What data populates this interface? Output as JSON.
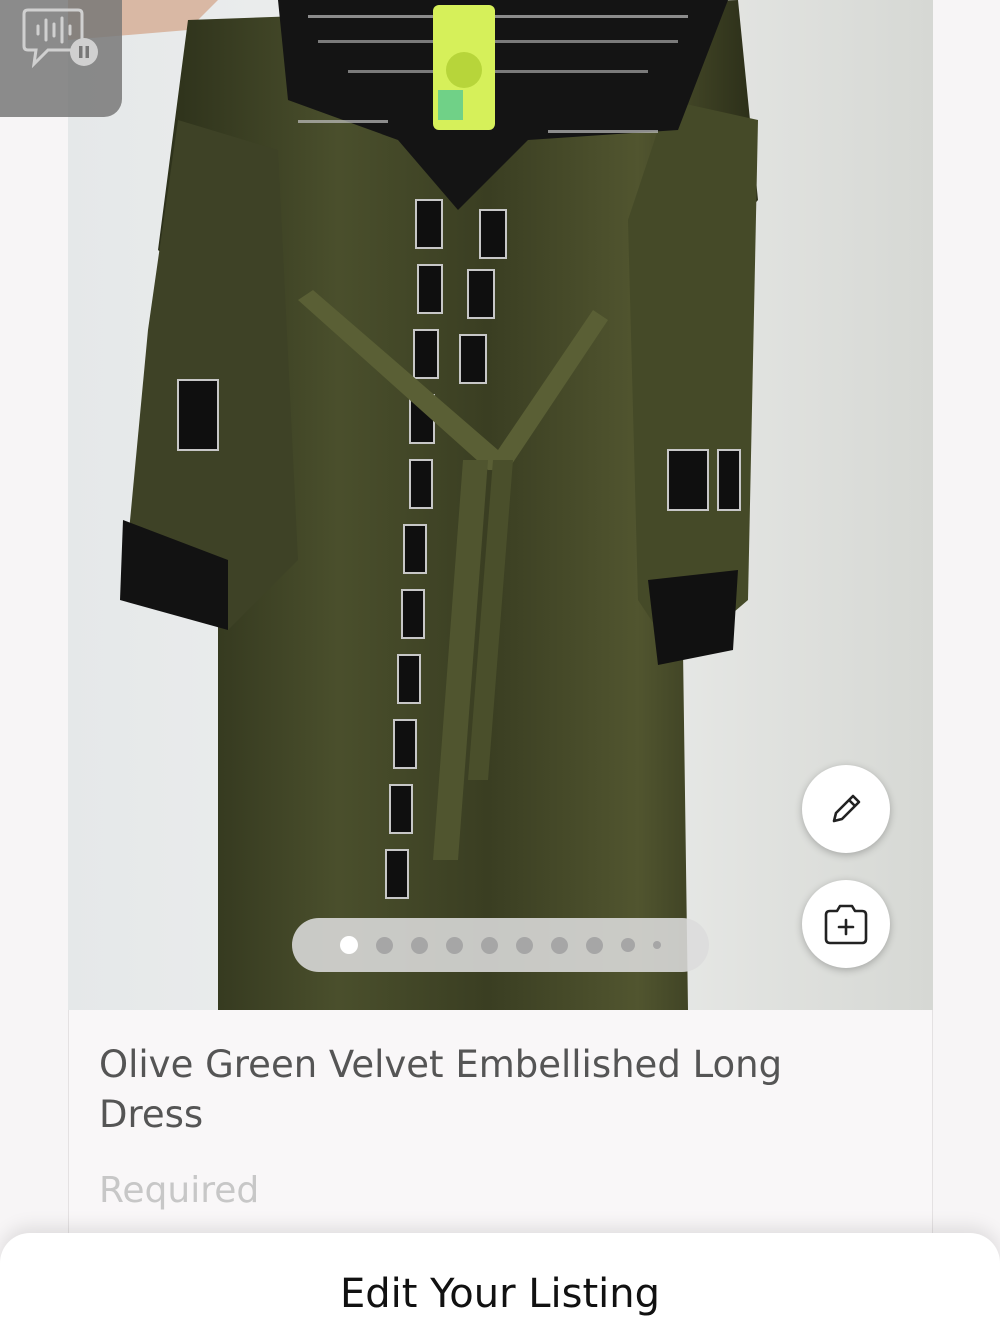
{
  "listing": {
    "title": "Olive Green Velvet Embellished Long Dress",
    "description_placeholder": "Required"
  },
  "sheet": {
    "title": "Edit Your Listing"
  },
  "photo": {
    "alt": "Olive Green Velvet Embellished Long Dress"
  },
  "pager": {
    "total": 10,
    "active_index": 0
  },
  "actions": {
    "edit_icon": "pencil-icon",
    "add_photo_icon": "camera-plus-icon"
  },
  "colors": {
    "dress": "#3b3f22",
    "accent_dark": "#111111",
    "placeholder": "#c7c7c7",
    "title_text": "#555555"
  }
}
